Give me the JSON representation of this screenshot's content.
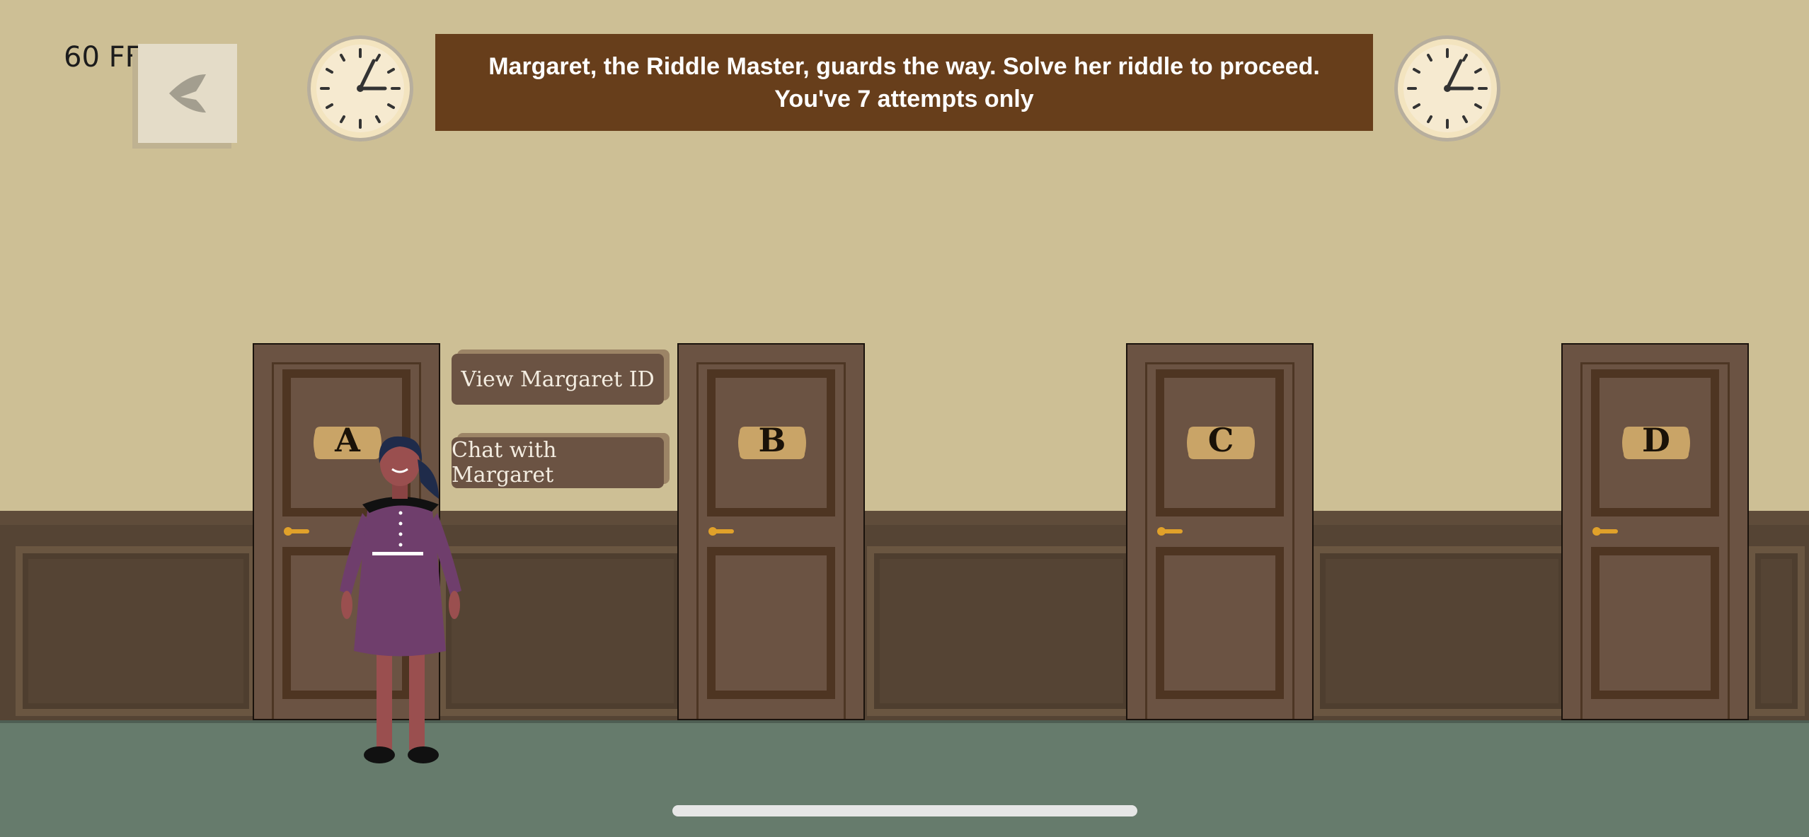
{
  "hud": {
    "fps": "60 FF"
  },
  "banner": {
    "text": "Margaret, the Riddle Master, guards the way. Solve her riddle to proceed. You've 7 attempts only"
  },
  "doors": [
    {
      "label": "A"
    },
    {
      "label": "B"
    },
    {
      "label": "C"
    },
    {
      "label": "D"
    }
  ],
  "actions": {
    "view_id": "View Margaret ID",
    "chat": "Chat with Margaret"
  },
  "colors": {
    "wall": "#cdbf95",
    "banner_bg": "#673e1b",
    "door": "#6b5343",
    "floor": "#667b6c",
    "dress": "#6f3e6c"
  },
  "icons": {
    "back": "back-arrow-icon",
    "clock": "clock-icon"
  }
}
